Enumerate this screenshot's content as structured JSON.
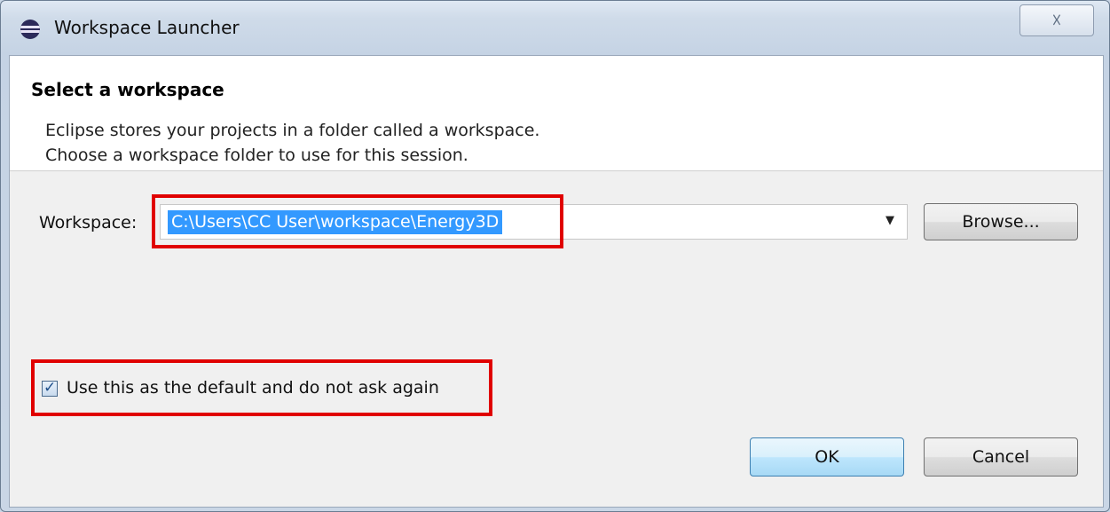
{
  "window": {
    "title": "Workspace Launcher",
    "close_glyph": "☓"
  },
  "banner": {
    "title": "Select a workspace",
    "description_line1": "Eclipse stores your projects in a folder called a workspace.",
    "description_line2": "Choose a workspace folder to use for this session."
  },
  "workspace": {
    "label": "Workspace:",
    "value": "C:\\Users\\CC User\\workspace\\Energy3D",
    "dropdown_glyph": "▼"
  },
  "buttons": {
    "browse": "Browse...",
    "ok": "OK",
    "cancel": "Cancel"
  },
  "default_option": {
    "checked": true,
    "check_glyph": "✓",
    "label": "Use this as the default and do not ask again"
  },
  "colors": {
    "highlight_box": "#e00000",
    "selection": "#3399ff"
  },
  "icons": {
    "app": "eclipse-icon",
    "close": "close-icon",
    "dropdown": "chevron-down-icon",
    "checkbox": "checkbox-checked-icon"
  }
}
